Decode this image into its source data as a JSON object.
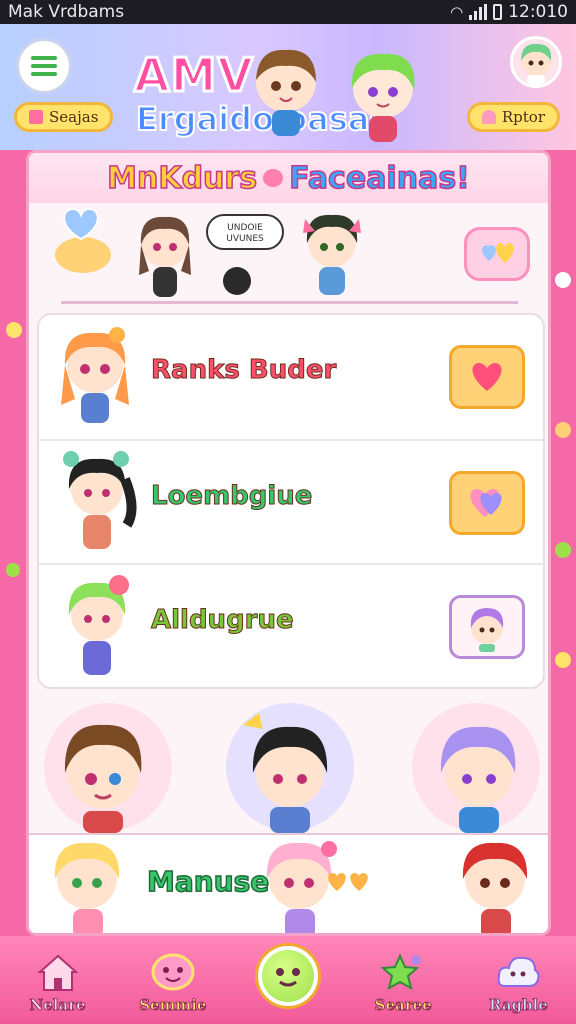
{
  "status_bar": {
    "title": "Mak Vrdbams",
    "time": "12:010"
  },
  "header": {
    "logo_line1": "AMV",
    "logo_line2": "Ergaido oasas",
    "left_pill": "Seajas",
    "right_pill": "Rptor"
  },
  "panel": {
    "title_part1": "MnKdurs",
    "title_part2": "Faceainas!",
    "speech_bubble": "UNDOIE\nUVUNES"
  },
  "list": [
    {
      "name": "Ranks Buder",
      "name_color": "#ff4f6d"
    },
    {
      "name": "Loembgiue",
      "name_color": "#37c76a"
    },
    {
      "name": "Alldugrue",
      "name_color": "#7ac63a"
    }
  ],
  "bottom_row": {
    "name": "Manuse"
  },
  "nav": {
    "items": [
      {
        "label": "Nelare",
        "icon": "house-icon",
        "color": "#ffd9ea"
      },
      {
        "label": "Semmie",
        "icon": "smile-icon",
        "color": "#ffe36b"
      },
      {
        "label": "",
        "icon": "face-icon",
        "color": "#b8f06a"
      },
      {
        "label": "Searee",
        "icon": "star-icon",
        "color": "#ffe36b"
      },
      {
        "label": "Ragble",
        "icon": "cloud-icon",
        "color": "#cde3ff"
      }
    ]
  },
  "colors": {
    "background": "#f56aa6",
    "panel": "#fdf4f8",
    "accent": "#ffd278",
    "nav": "#f25a9a"
  }
}
